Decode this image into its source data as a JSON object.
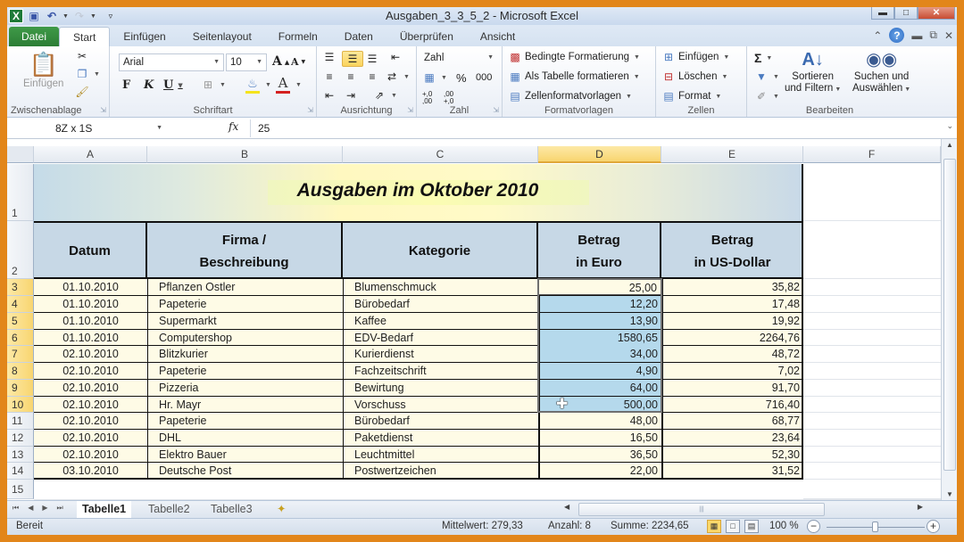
{
  "window": {
    "title": "Ausgaben_3_3_5_2 - Microsoft Excel",
    "controls": [
      "minimize",
      "maximize",
      "close"
    ]
  },
  "quick_access": {
    "icons": [
      "excel-logo-icon",
      "save-icon",
      "undo-icon",
      "redo-icon",
      "customize-qat-icon"
    ]
  },
  "ribbon_tabs": [
    {
      "label": "Datei",
      "active": false
    },
    {
      "label": "Start",
      "active": true
    },
    {
      "label": "Einfügen",
      "active": false
    },
    {
      "label": "Seitenlayout",
      "active": false
    },
    {
      "label": "Formeln",
      "active": false
    },
    {
      "label": "Daten",
      "active": false
    },
    {
      "label": "Überprüfen",
      "active": false
    },
    {
      "label": "Ansicht",
      "active": false
    }
  ],
  "ribbon": {
    "clipboard": {
      "paste_label": "Einfügen",
      "group_label": "Zwischenablage"
    },
    "font": {
      "font_name": "Arial",
      "font_size": "10",
      "bold": "F",
      "italic": "K",
      "underline": "U",
      "grow": "A",
      "shrink": "A",
      "group_label": "Schriftart",
      "fill_color": "#f5e31c",
      "font_color": "#d42020"
    },
    "alignment": {
      "group_label": "Ausrichtung"
    },
    "number": {
      "format": "Zahl",
      "percent": "%",
      "thousands": "000",
      "inc_decimal": "+,0 ,00",
      "dec_decimal": ",00 +,0",
      "group_label": "Zahl"
    },
    "styles": {
      "conditional": "Bedingte Formatierung",
      "as_table": "Als Tabelle formatieren",
      "cell_styles": "Zellenformatvorlagen",
      "group_label": "Formatvorlagen"
    },
    "cells": {
      "insert": "Einfügen",
      "delete": "Löschen",
      "format": "Format",
      "group_label": "Zellen"
    },
    "editing": {
      "sum": "Σ",
      "sort_line1": "Sortieren",
      "sort_line2": "und Filtern",
      "find_line1": "Suchen und",
      "find_line2": "Auswählen",
      "group_label": "Bearbeiten"
    }
  },
  "formula_bar": {
    "name_box": "8Z x 1S",
    "fx": "fx",
    "formula": "25"
  },
  "columns": [
    "A",
    "B",
    "C",
    "D",
    "E",
    "F"
  ],
  "selected_column": "D",
  "rows": [
    "1",
    "2",
    "3",
    "4",
    "5",
    "6",
    "7",
    "8",
    "9",
    "10",
    "11",
    "12",
    "13",
    "14",
    "15"
  ],
  "selected_rows": [
    "3",
    "4",
    "5",
    "6",
    "7",
    "8",
    "9",
    "10"
  ],
  "sheet": {
    "title": "Ausgaben im Oktober 2010",
    "headers": [
      {
        "line1": "Datum",
        "line2": ""
      },
      {
        "line1": "Firma /",
        "line2": "Beschreibung"
      },
      {
        "line1": "Kategorie",
        "line2": ""
      },
      {
        "line1": "Betrag",
        "line2": "in Euro"
      },
      {
        "line1": "Betrag",
        "line2": "in US-Dollar"
      }
    ],
    "data": [
      {
        "datum": "01.10.2010",
        "firma": "Pflanzen Ostler",
        "kategorie": "Blumenschmuck",
        "euro": "25,00",
        "usd": "35,82"
      },
      {
        "datum": "01.10.2010",
        "firma": "Papeterie",
        "kategorie": "Bürobedarf",
        "euro": "12,20",
        "usd": "17,48"
      },
      {
        "datum": "01.10.2010",
        "firma": "Supermarkt",
        "kategorie": "Kaffee",
        "euro": "13,90",
        "usd": "19,92"
      },
      {
        "datum": "01.10.2010",
        "firma": "Computershop",
        "kategorie": "EDV-Bedarf",
        "euro": "1580,65",
        "usd": "2264,76"
      },
      {
        "datum": "02.10.2010",
        "firma": "Blitzkurier",
        "kategorie": "Kurierdienst",
        "euro": "34,00",
        "usd": "48,72"
      },
      {
        "datum": "02.10.2010",
        "firma": "Papeterie",
        "kategorie": "Fachzeitschrift",
        "euro": "4,90",
        "usd": "7,02"
      },
      {
        "datum": "02.10.2010",
        "firma": "Pizzeria",
        "kategorie": "Bewirtung",
        "euro": "64,00",
        "usd": "91,70"
      },
      {
        "datum": "02.10.2010",
        "firma": "Hr. Mayr",
        "kategorie": "Vorschuss",
        "euro": "500,00",
        "usd": "716,40"
      },
      {
        "datum": "02.10.2010",
        "firma": "Papeterie",
        "kategorie": "Bürobedarf",
        "euro": "48,00",
        "usd": "68,77"
      },
      {
        "datum": "02.10.2010",
        "firma": "DHL",
        "kategorie": "Paketdienst",
        "euro": "16,50",
        "usd": "23,64"
      },
      {
        "datum": "02.10.2010",
        "firma": "Elektro Bauer",
        "kategorie": "Leuchtmittel",
        "euro": "36,50",
        "usd": "52,30"
      },
      {
        "datum": "03.10.2010",
        "firma": "Deutsche Post",
        "kategorie": "Postwertzeichen",
        "euro": "22,00",
        "usd": "31,52"
      }
    ]
  },
  "sheet_tabs": [
    {
      "label": "Tabelle1",
      "active": true
    },
    {
      "label": "Tabelle2",
      "active": false
    },
    {
      "label": "Tabelle3",
      "active": false
    }
  ],
  "status_bar": {
    "mode": "Bereit",
    "average": "Mittelwert: 279,33",
    "count": "Anzahl: 8",
    "sum": "Summe: 2234,65",
    "zoom": "100 %",
    "zoom_level_percent": 100
  },
  "colors": {
    "frame": "#e2861a",
    "datei_tab": "#2c7d35",
    "title_band": "#fffac8",
    "header_fill": "#c7d8e6",
    "row_fill": "#fefbe6",
    "selection_fill": "#b5d9ec",
    "selected_header": "#f8d570"
  }
}
